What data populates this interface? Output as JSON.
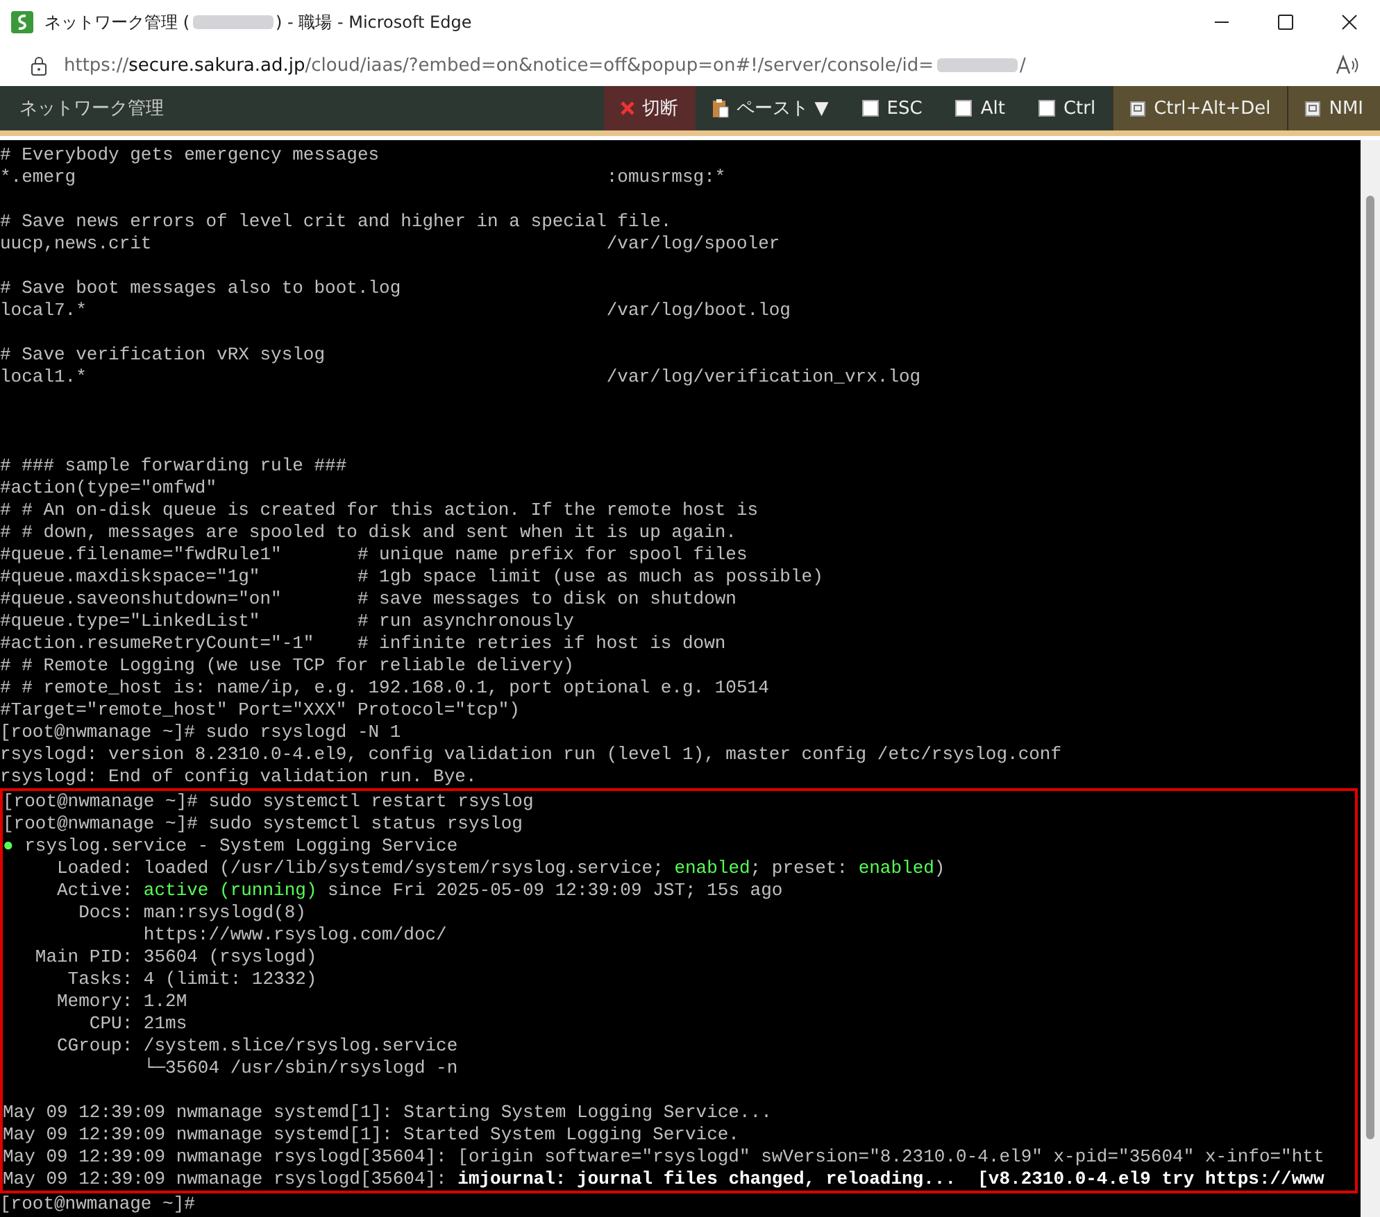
{
  "window": {
    "title_start": "ネットワーク管理 (",
    "title_end": ") - 職場 - Microsoft Edge"
  },
  "address_bar": {
    "scheme": "https://",
    "host": "secure.sakura.ad.jp",
    "path": "/cloud/iaas/?embed=on&notice=off&popup=on#!/server/console/id=",
    "path_end": "/"
  },
  "toolbar": {
    "title": "ネットワーク管理",
    "buttons": [
      {
        "kind": "disconnect",
        "label": "切断"
      },
      {
        "kind": "paste",
        "label": "ペースト ▼"
      },
      {
        "kind": "toggle",
        "label": "ESC",
        "checked": false
      },
      {
        "kind": "toggle",
        "label": "Alt",
        "checked": false
      },
      {
        "kind": "toggle",
        "label": "Ctrl",
        "checked": false
      },
      {
        "kind": "key",
        "label": "Ctrl+Alt+Del"
      },
      {
        "kind": "key",
        "label": "NMI"
      }
    ]
  },
  "terminal": {
    "lines_before": [
      {
        "kind": "text",
        "text": "# Everybody gets emergency messages"
      },
      {
        "kind": "config",
        "cells": [
          "*.emerg",
          ":omusrmsg:*"
        ]
      },
      {
        "kind": "blank"
      },
      {
        "kind": "text",
        "text": "# Save news errors of level crit and higher in a special file."
      },
      {
        "kind": "config",
        "cells": [
          "uucp,news.crit",
          "/var/log/spooler"
        ]
      },
      {
        "kind": "blank"
      },
      {
        "kind": "text",
        "text": "# Save boot messages also to boot.log"
      },
      {
        "kind": "config",
        "cells": [
          "local7.*",
          "/var/log/boot.log"
        ]
      },
      {
        "kind": "blank"
      },
      {
        "kind": "text",
        "text": "# Save verification vRX syslog"
      },
      {
        "kind": "config",
        "cells": [
          "local1.*",
          "/var/log/verification_vrx.log"
        ]
      },
      {
        "kind": "blank"
      },
      {
        "kind": "blank"
      },
      {
        "kind": "blank"
      },
      {
        "kind": "text",
        "text": "# ### sample forwarding rule ###"
      },
      {
        "kind": "text",
        "text": "#action(type=\"omfwd\""
      },
      {
        "kind": "text",
        "text": "# # An on-disk queue is created for this action. If the remote host is"
      },
      {
        "kind": "text",
        "text": "# # down, messages are spooled to disk and sent when it is up again."
      },
      {
        "kind": "option",
        "cells": [
          "#queue.filename=\"fwdRule1\"",
          "# unique name prefix for spool files"
        ]
      },
      {
        "kind": "option",
        "cells": [
          "#queue.maxdiskspace=\"1g\"",
          "# 1gb space limit (use as much as possible)"
        ]
      },
      {
        "kind": "option",
        "cells": [
          "#queue.saveonshutdown=\"on\"",
          "# save messages to disk on shutdown"
        ]
      },
      {
        "kind": "option",
        "cells": [
          "#queue.type=\"LinkedList\"",
          "# run asynchronously"
        ]
      },
      {
        "kind": "option",
        "cells": [
          "#action.resumeRetryCount=\"-1\"",
          "# infinite retries if host is down"
        ]
      },
      {
        "kind": "text",
        "text": "# # Remote Logging (we use TCP for reliable delivery)"
      },
      {
        "kind": "text",
        "text": "# # remote_host is: name/ip, e.g. 192.168.0.1, port optional e.g. 10514"
      },
      {
        "kind": "text",
        "text": "#Target=\"remote_host\" Port=\"XXX\" Protocol=\"tcp\")"
      },
      {
        "kind": "text",
        "text": "[root@nwmanage ~]# sudo rsyslogd -N 1"
      },
      {
        "kind": "text",
        "text": "rsyslogd: version 8.2310.0-4.el9, config validation run (level 1), master config /etc/rsyslog.conf"
      },
      {
        "kind": "text",
        "text": "rsyslogd: End of config validation run. Bye."
      }
    ],
    "highlighted_lines": [
      {
        "kind": "text",
        "text": "[root@nwmanage ~]# sudo systemctl restart rsyslog"
      },
      {
        "kind": "text",
        "text": "[root@nwmanage ~]# sudo systemctl status rsyslog"
      },
      {
        "kind": "styled",
        "segments": [
          {
            "text": "●",
            "kind": "ok"
          },
          {
            "text": " rsyslog.service - System Logging Service",
            "kind": "plain"
          }
        ]
      },
      {
        "kind": "styled",
        "segments": [
          {
            "text": "     Loaded: loaded (/usr/lib/systemd/system/rsyslog.service; ",
            "kind": "plain"
          },
          {
            "text": "enabled",
            "kind": "ok"
          },
          {
            "text": "; preset: ",
            "kind": "plain"
          },
          {
            "text": "enabled",
            "kind": "ok"
          },
          {
            "text": ")",
            "kind": "plain"
          }
        ]
      },
      {
        "kind": "styled",
        "segments": [
          {
            "text": "     Active: ",
            "kind": "plain"
          },
          {
            "text": "active (running)",
            "kind": "ok"
          },
          {
            "text": " since Fri 2025-05-09 12:39:09 JST; 15s ago",
            "kind": "plain"
          }
        ]
      },
      {
        "kind": "text",
        "text": "       Docs: man:rsyslogd(8)"
      },
      {
        "kind": "text",
        "text": "             https://www.rsyslog.com/doc/"
      },
      {
        "kind": "text",
        "text": "   Main PID: 35604 (rsyslogd)"
      },
      {
        "kind": "text",
        "text": "      Tasks: 4 (limit: 12332)"
      },
      {
        "kind": "text",
        "text": "     Memory: 1.2M"
      },
      {
        "kind": "text",
        "text": "        CPU: 21ms"
      },
      {
        "kind": "text",
        "text": "     CGroup: /system.slice/rsyslog.service"
      },
      {
        "kind": "text",
        "text": "             └─35604 /usr/sbin/rsyslogd -n"
      },
      {
        "kind": "blank"
      },
      {
        "kind": "text",
        "text": "May 09 12:39:09 nwmanage systemd[1]: Starting System Logging Service..."
      },
      {
        "kind": "text",
        "text": "May 09 12:39:09 nwmanage systemd[1]: Started System Logging Service."
      },
      {
        "kind": "text",
        "text": "May 09 12:39:09 nwmanage rsyslogd[35604]: [origin software=\"rsyslogd\" swVersion=\"8.2310.0-4.el9\" x-pid=\"35604\" x-info=\"htt"
      },
      {
        "kind": "styled",
        "segments": [
          {
            "text": "May 09 12:39:09 nwmanage rsyslogd[35604]: ",
            "kind": "plain"
          },
          {
            "text": "imjournal: journal files changed, reloading...  [v8.2310.0-4.el9 try https://www",
            "kind": "notice"
          }
        ]
      }
    ],
    "lines_after": [
      {
        "kind": "text",
        "text": "[root@nwmanage ~]# "
      }
    ]
  }
}
